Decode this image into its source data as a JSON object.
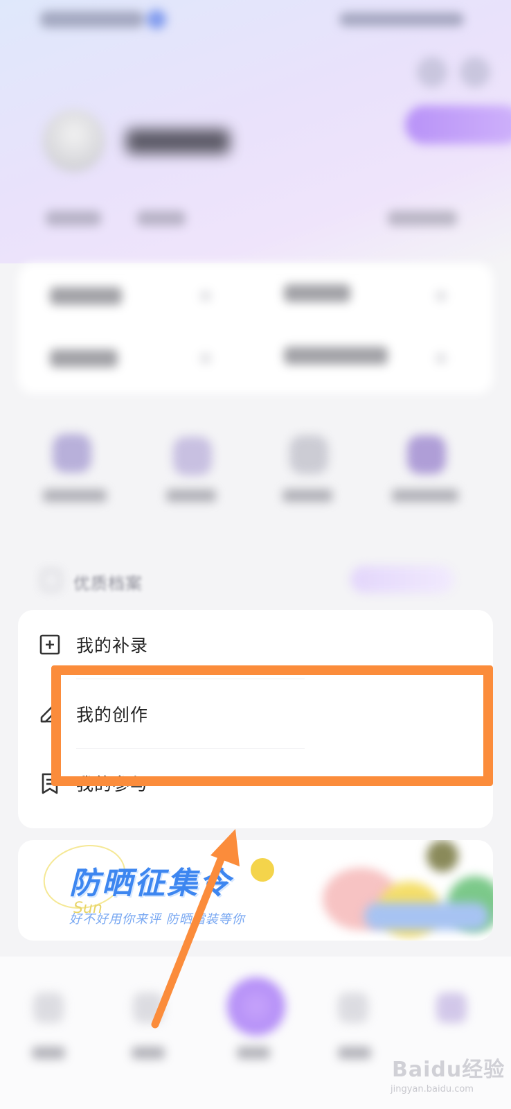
{
  "menu": {
    "archive_label": "优质档案",
    "items": [
      {
        "label": "我的补录",
        "icon": "plus-square-icon"
      },
      {
        "label": "我的创作",
        "icon": "pen-icon"
      },
      {
        "label": "我的参与",
        "icon": "bookmark-list-icon"
      }
    ]
  },
  "banner": {
    "title": "防晒征集令",
    "subtitle": "好不好用你来评  防晒霜装等你",
    "script": "Sun"
  },
  "annotation": {
    "highlight_color": "#fb8c3b",
    "highlighted_item": "我的创作"
  },
  "watermark": {
    "brand": "Baidu经验",
    "url": "jingyan.baidu.com"
  },
  "colors": {
    "accent": "#b892f7",
    "banner_blue": "#3d86f0",
    "annotation_orange": "#fb8c3b"
  }
}
